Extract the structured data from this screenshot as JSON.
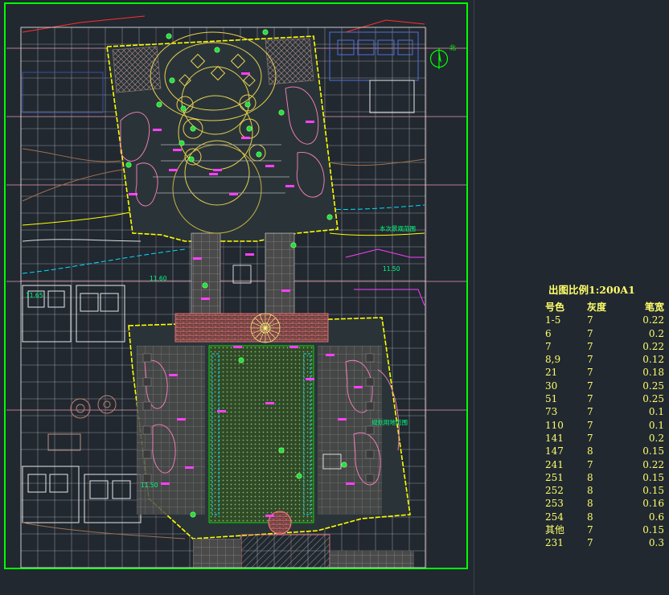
{
  "drawing": {
    "colors": {
      "background": "#212830",
      "frame": "#00ff00",
      "grid": "#e89ab0",
      "boundary": "#ffff00",
      "paving": "#d0d0d0",
      "planting": "#3a5a2a",
      "magenta": "#ff40ff",
      "cyan": "#00e0ff",
      "blue": "#4060d0",
      "white": "#e8e8e8",
      "red": "#ff3030"
    },
    "north_label": "北",
    "annotations": [
      {
        "id": "a1",
        "text": "本次景观范围"
      },
      {
        "id": "a2",
        "text": "规划用地范围"
      },
      {
        "id": "a3",
        "text": "11.50"
      },
      {
        "id": "a4",
        "text": "11.60"
      },
      {
        "id": "a5",
        "text": "11.65"
      },
      {
        "id": "a6",
        "text": "11.50"
      }
    ]
  },
  "legend": {
    "title": "出图比例1:200A1",
    "headers": [
      "号色",
      "灰度",
      "笔宽"
    ],
    "rows": [
      [
        "1-5",
        "7",
        "0.22"
      ],
      [
        "6",
        "7",
        "0.2"
      ],
      [
        "7",
        "7",
        "0.22"
      ],
      [
        "8,9",
        "7",
        "0.12"
      ],
      [
        "21",
        "7",
        "0.18"
      ],
      [
        "30",
        "7",
        "0.25"
      ],
      [
        "51",
        "7",
        "0.25"
      ],
      [
        "73",
        "7",
        "0.1"
      ],
      [
        "110",
        "7",
        "0.1"
      ],
      [
        "141",
        "7",
        "0.2"
      ],
      [
        "147",
        "8",
        "0.15"
      ],
      [
        "241",
        "7",
        "0.22"
      ],
      [
        "251",
        "8",
        "0.15"
      ],
      [
        "252",
        "8",
        "0.15"
      ],
      [
        "253",
        "8",
        "0.16"
      ],
      [
        "254",
        "8",
        "0.6"
      ],
      [
        "其他",
        "7",
        "0.15"
      ],
      [
        "231",
        "7",
        "0.3"
      ]
    ]
  }
}
